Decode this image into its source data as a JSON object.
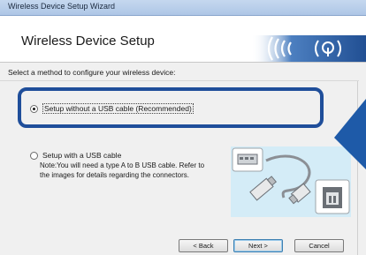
{
  "window": {
    "title": "Wireless Device Setup Wizard"
  },
  "header": {
    "title": "Wireless Device Setup",
    "brand_icon": "wireless-arcs-icon"
  },
  "instruction": "Select a method to configure your wireless device:",
  "options": [
    {
      "label": "Setup without a USB cable (Recommended)",
      "selected": true
    },
    {
      "label": "Setup with a USB cable",
      "selected": false
    }
  ],
  "note": {
    "line1": "Note:You will need a type A to B USB cable. Refer to",
    "line2": "the images for details regarding the connectors."
  },
  "buttons": {
    "back": "< Back",
    "next": "Next >",
    "cancel": "Cancel"
  },
  "colors": {
    "highlight_border": "#1f4e9a",
    "header_band": "#2b5fa6",
    "callout_arrow": "#1e5aa8"
  }
}
